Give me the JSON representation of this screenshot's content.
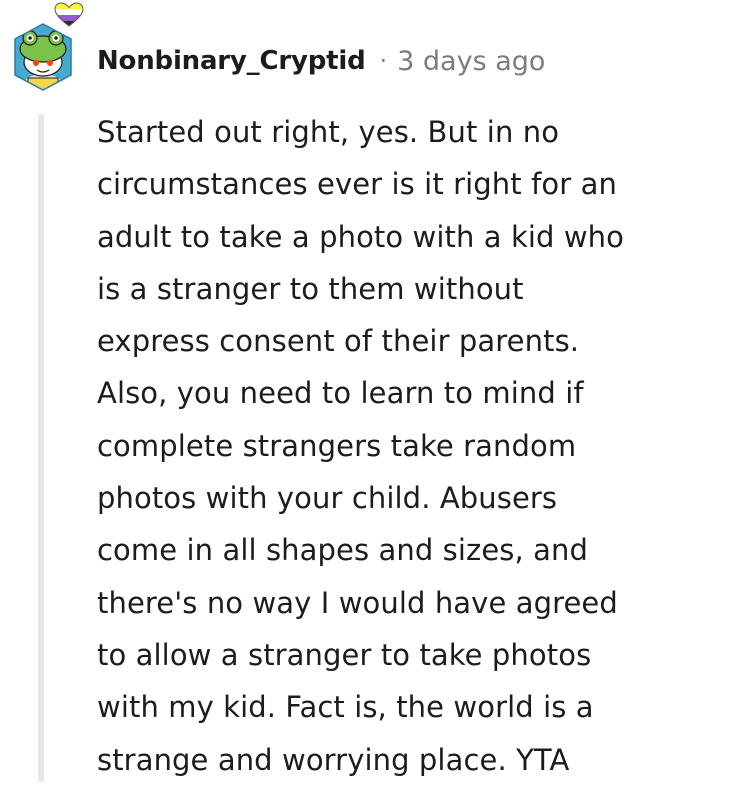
{
  "comment": {
    "username": "Nonbinary_Cryptid",
    "separator": "·",
    "timestamp": "3 days ago",
    "flair_colors": [
      "#fcf434",
      "#ffffff",
      "#9c59d1",
      "#2c2c2c"
    ],
    "avatar_icon": "snoo-frog-hat-avatar-icon",
    "body_lines": [
      "Started out right, yes. But in no",
      "circumstances ever is it right for an",
      "adult to take a photo with a kid who",
      "is a stranger to them without",
      "express consent of their parents.",
      "Also, you need to learn to mind if",
      "complete strangers take random",
      "photos with your child. Abusers",
      "come in all shapes and sizes, and",
      "there's no way I would have agreed",
      "to allow a stranger to take photos",
      "with my kid. Fact is, the world is a",
      "strange and worrying place. YTA"
    ]
  }
}
